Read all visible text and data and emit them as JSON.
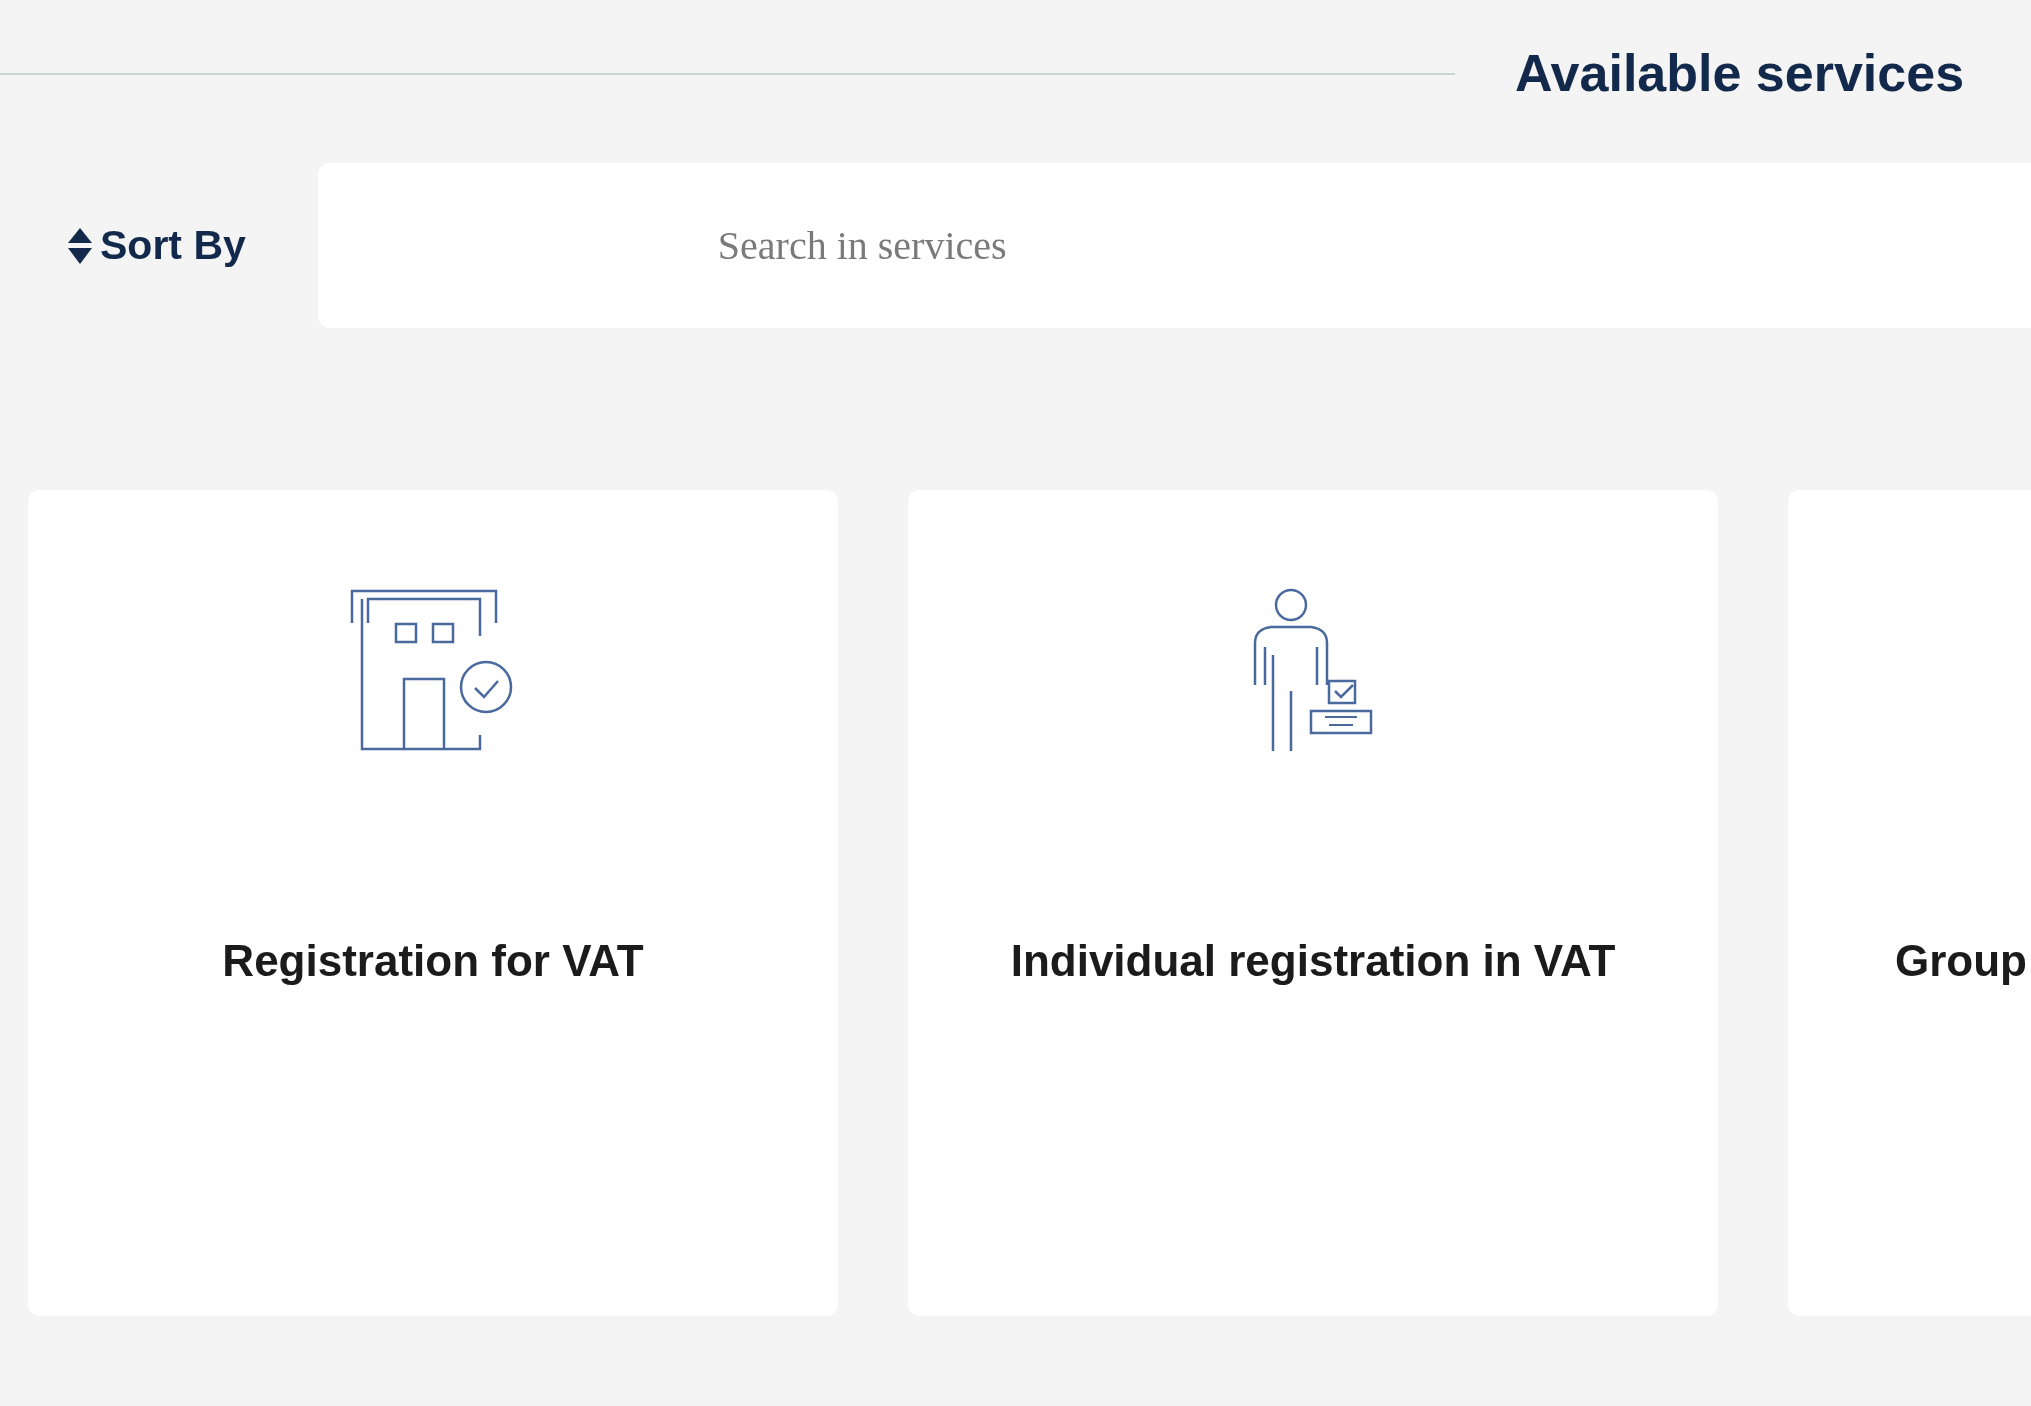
{
  "header": {
    "title": "Available services"
  },
  "toolbar": {
    "sort_label": "Sort By",
    "search": {
      "placeholder": "Search in services"
    }
  },
  "services": [
    {
      "title": "Registration for VAT",
      "kind": "building"
    },
    {
      "title": "Individual registration in VAT",
      "kind": "person"
    },
    {
      "title": "Group",
      "kind": "cut"
    }
  ]
}
